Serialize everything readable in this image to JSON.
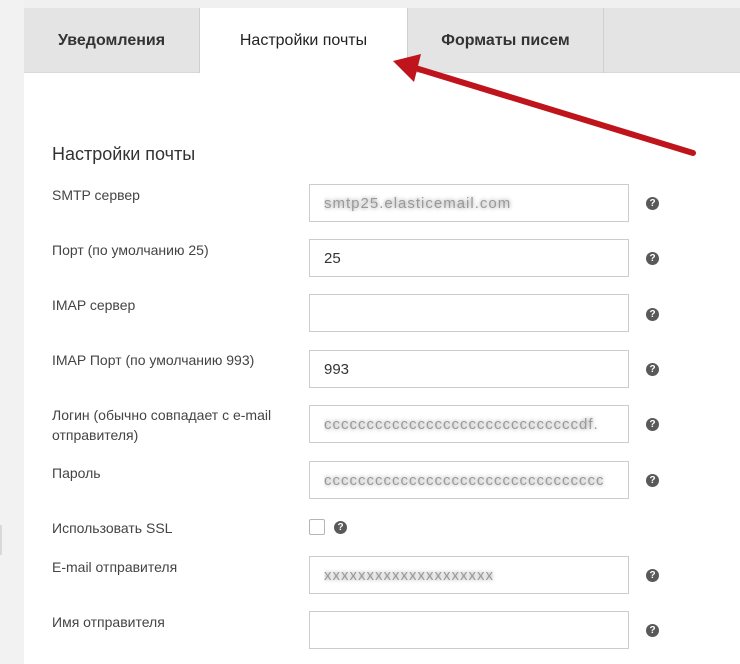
{
  "tabs": [
    {
      "label": "Уведомления"
    },
    {
      "label": "Настройки почты"
    },
    {
      "label": "Форматы писем"
    }
  ],
  "active_tab": "Настройки почты",
  "section_title": "Настройки почты",
  "fields": {
    "smtp_server": {
      "label": "SMTP сервер",
      "value": "smtp25.elasticemail.com"
    },
    "port": {
      "label": "Порт (по умолчанию 25)",
      "value": "25"
    },
    "imap_server": {
      "label": "IMAP сервер",
      "value": ""
    },
    "imap_port": {
      "label": "IMAP Порт (по умолчанию 993)",
      "value": "993"
    },
    "login": {
      "label": "Логин (обычно совпадает с e-mail отправителя)",
      "value": "ccccccccccccccccccccccccccccccdf."
    },
    "password": {
      "label": "Пароль",
      "value": "ccccccccccccccccccccccccccccccccc"
    },
    "use_ssl": {
      "label": "Использовать SSL",
      "checked": false
    },
    "sender_email": {
      "label": "E-mail отправителя",
      "value": "xxxxxxxxxxxxxxxxxxxx"
    },
    "sender_name": {
      "label": "Имя отправителя",
      "value": ""
    }
  },
  "help_glyph": "?",
  "colors": {
    "annotation_arrow": "#c0141c",
    "tab_bar": "#e4e4e4",
    "help_icon": "#595959"
  }
}
